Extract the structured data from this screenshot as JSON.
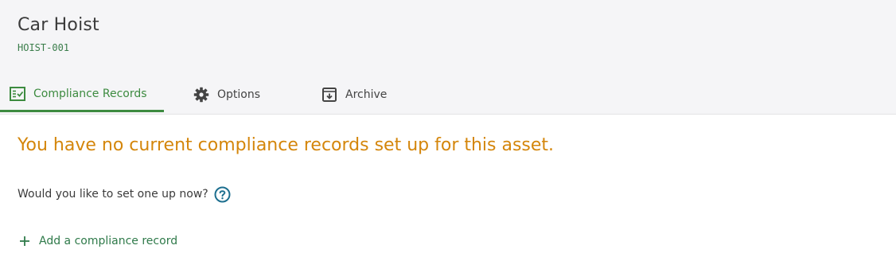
{
  "asset": {
    "title": "Car Hoist",
    "code": "HOIST-001"
  },
  "tabs": [
    {
      "label": "Compliance Records",
      "icon": "checklist-icon",
      "active": true
    },
    {
      "label": "Options",
      "icon": "gear-icon",
      "active": false
    },
    {
      "label": "Archive",
      "icon": "archive-icon",
      "active": false
    }
  ],
  "main": {
    "notice": "You have no current compliance records set up for this asset.",
    "question": "Would you like to set one up now?",
    "help_icon": "question-circle-icon",
    "add_label": "Add a compliance record"
  },
  "colors": {
    "accent_green": "#3d8b40",
    "warning_orange": "#d4860b",
    "help_blue": "#1d6f8f"
  }
}
